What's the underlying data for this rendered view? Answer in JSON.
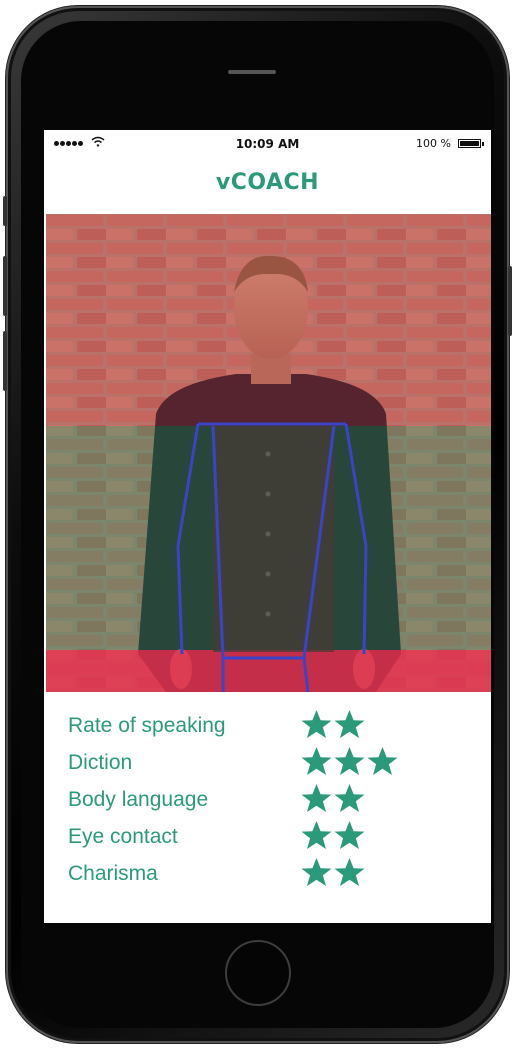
{
  "status_bar": {
    "time": "10:09 AM",
    "battery": "100 %"
  },
  "app": {
    "title": "vCOACH",
    "accent_color": "#2b9a7a"
  },
  "metrics": [
    {
      "label": "Rate of speaking",
      "stars": 2
    },
    {
      "label": "Diction",
      "stars": 3
    },
    {
      "label": "Body language",
      "stars": 2
    },
    {
      "label": "Eye contact",
      "stars": 2
    },
    {
      "label": "Charisma",
      "stars": 2
    }
  ]
}
